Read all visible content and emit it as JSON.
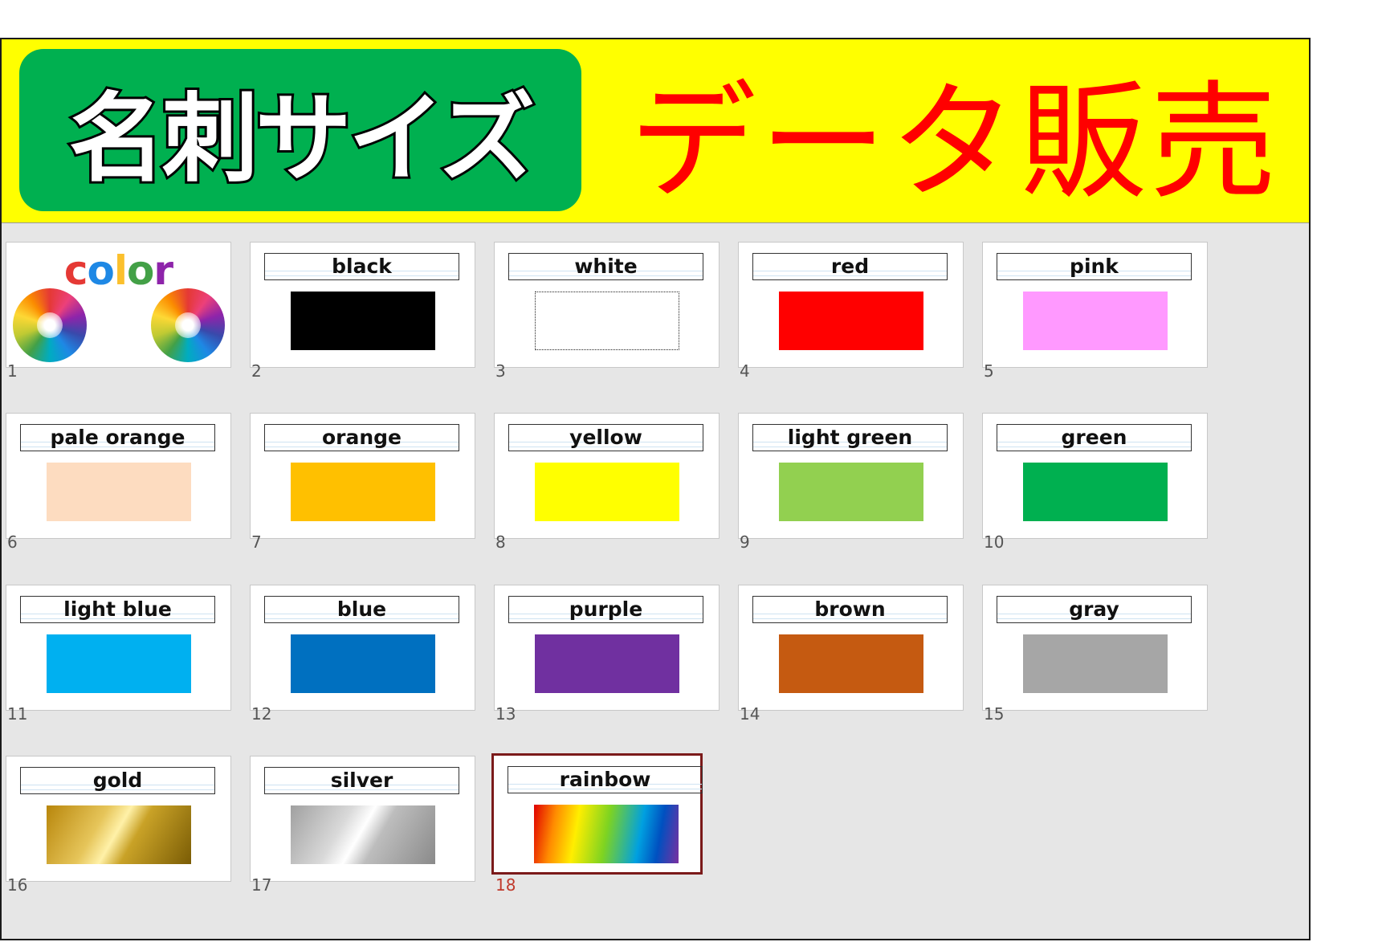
{
  "banner": {
    "title_left": "名刺サイズ",
    "title_right": "データ販売"
  },
  "cover": {
    "title_letters": [
      {
        "ch": "c",
        "color": "#e53935"
      },
      {
        "ch": "o",
        "color": "#1e88e5"
      },
      {
        "ch": "l",
        "color": "#fbc02d"
      },
      {
        "ch": "o",
        "color": "#43a047"
      },
      {
        "ch": "r",
        "color": "#8e24aa"
      }
    ],
    "number": "1"
  },
  "slides": [
    {
      "number": "2",
      "label": "black",
      "color": "#000000"
    },
    {
      "number": "3",
      "label": "white",
      "color": "#ffffff"
    },
    {
      "number": "4",
      "label": "red",
      "color": "#ff0000"
    },
    {
      "number": "5",
      "label": "pink",
      "color": "#ff99ff"
    },
    {
      "number": "6",
      "label": "pale orange",
      "color": "#fddcc0"
    },
    {
      "number": "7",
      "label": "orange",
      "color": "#ffc000"
    },
    {
      "number": "8",
      "label": "yellow",
      "color": "#ffff00"
    },
    {
      "number": "9",
      "label": "light green",
      "color": "#92d050"
    },
    {
      "number": "10",
      "label": "green",
      "color": "#00b050"
    },
    {
      "number": "11",
      "label": "light blue",
      "color": "#00b0f0"
    },
    {
      "number": "12",
      "label": "blue",
      "color": "#0070c0"
    },
    {
      "number": "13",
      "label": "purple",
      "color": "#7030a0"
    },
    {
      "number": "14",
      "label": "brown",
      "color": "#c55a11"
    },
    {
      "number": "15",
      "label": "gray",
      "color": "#a6a6a6"
    },
    {
      "number": "16",
      "label": "gold",
      "color": "gold-gradient"
    },
    {
      "number": "17",
      "label": "silver",
      "color": "silver-gradient"
    },
    {
      "number": "18",
      "label": "rainbow",
      "color": "rainbow-gradient",
      "selected": true
    }
  ]
}
